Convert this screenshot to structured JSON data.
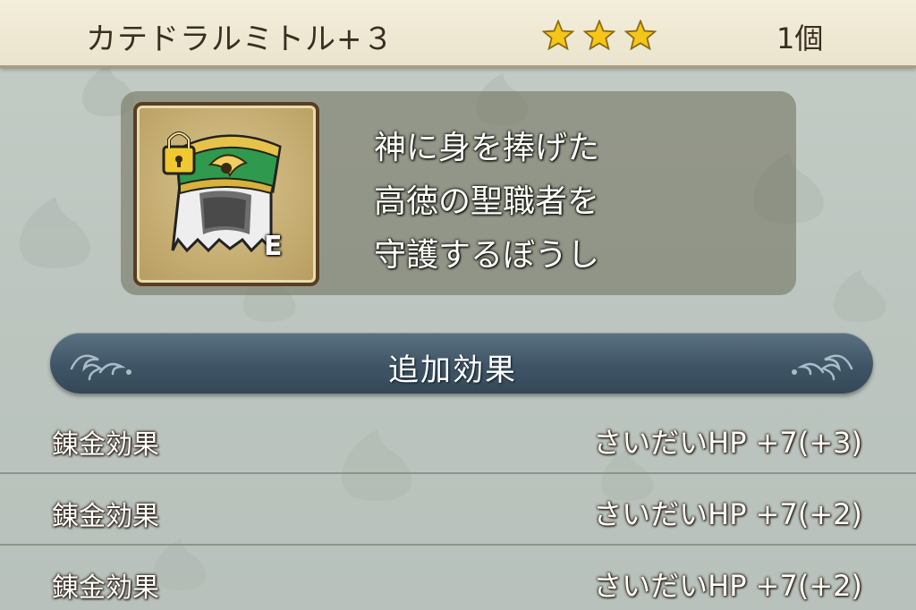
{
  "header": {
    "item_name": "カテドラルミトル+３",
    "rarity_stars": 3,
    "quantity": "1個"
  },
  "item": {
    "icon": "bishop-mitre-icon",
    "locked": true,
    "equipped_label": "E",
    "description": [
      "神に身を捧げた",
      "高徳の聖職者を",
      "守護するぼうし"
    ]
  },
  "section": {
    "title": "追加効果"
  },
  "effects": [
    {
      "label": "錬金効果",
      "value": "さいだいHP  +7(+3)"
    },
    {
      "label": "錬金効果",
      "value": "さいだいHP  +7(+2)"
    },
    {
      "label": "錬金効果",
      "value": "さいだいHP  +7(+2)"
    }
  ],
  "colors": {
    "header_bg": "#f3eedb",
    "star": "#f5c518",
    "bar_bg": "#3f5566",
    "mitre_green": "#2f9a4e",
    "gold": "#d8b23a"
  }
}
